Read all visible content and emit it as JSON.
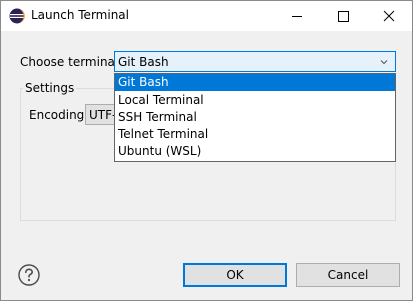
{
  "window": {
    "title": "Launch Terminal",
    "icon": "eclipse-icon"
  },
  "controls": {
    "minimize_icon": "minimize-icon",
    "maximize_icon": "maximize-icon",
    "close_icon": "close-icon"
  },
  "form": {
    "terminal_label": "Choose terminal:",
    "terminal_value": "Git Bash",
    "settings_title": "Settings",
    "encoding_label": "Encoding:",
    "encoding_value": "UTF-8"
  },
  "dropdown": {
    "options": [
      "Git Bash",
      "Local Terminal",
      "SSH Terminal",
      "Telnet Terminal",
      "Ubuntu (WSL)"
    ],
    "selected_index": 0
  },
  "buttons": {
    "ok": "OK",
    "cancel": "Cancel",
    "help_icon": "help-icon"
  },
  "colors": {
    "selection": "#0078d7",
    "combo_bg": "#e5f1fb"
  }
}
